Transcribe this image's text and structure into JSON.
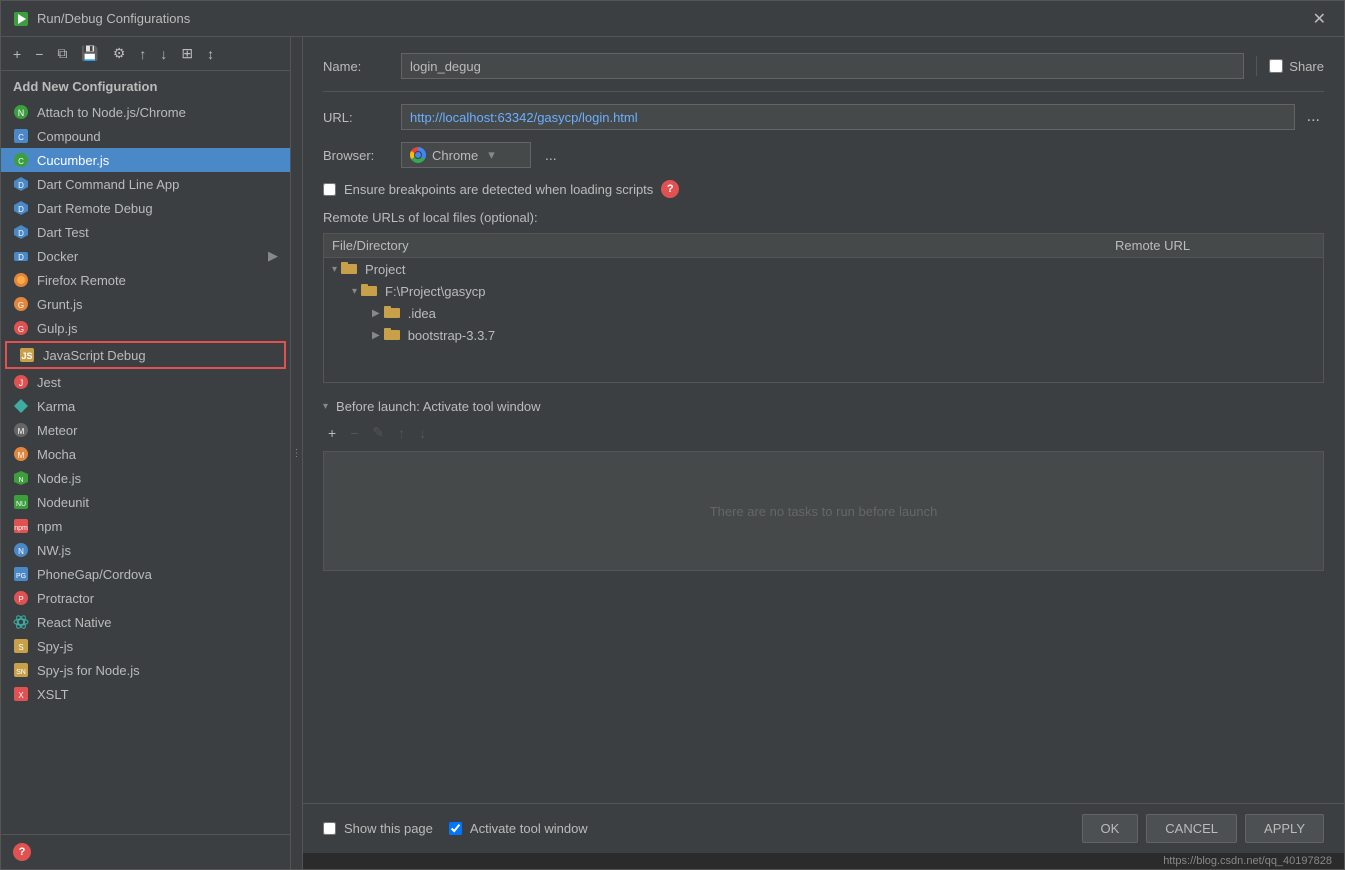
{
  "dialog": {
    "title": "Run/Debug Configurations",
    "close_label": "✕"
  },
  "toolbar": {
    "add_label": "+",
    "remove_label": "−",
    "copy_label": "⧉",
    "save_label": "💾",
    "settings_label": "⚙",
    "move_up_label": "↑",
    "move_down_label": "↓",
    "layout_label": "⊞",
    "sort_label": "↕"
  },
  "left_panel": {
    "title": "Add New Configuration",
    "items": [
      {
        "id": "attach-nodejs-chrome",
        "label": "Attach to Node.js/Chrome",
        "icon": "nodejs",
        "color": "#3d9e3d"
      },
      {
        "id": "compound",
        "label": "Compound",
        "icon": "compound",
        "color": "#4a88c7"
      },
      {
        "id": "cucumberjs",
        "label": "Cucumber.js",
        "icon": "cucumber",
        "color": "#3d9e3d",
        "selected": true
      },
      {
        "id": "dart-command-line",
        "label": "Dart Command Line App",
        "icon": "dart",
        "color": "#4a88c7"
      },
      {
        "id": "dart-remote-debug",
        "label": "Dart Remote Debug",
        "icon": "dart",
        "color": "#4a88c7"
      },
      {
        "id": "dart-test",
        "label": "Dart Test",
        "icon": "dart",
        "color": "#4a88c7"
      },
      {
        "id": "docker",
        "label": "Docker",
        "icon": "docker",
        "color": "#4a88c7",
        "has_arrow": true
      },
      {
        "id": "firefox-remote",
        "label": "Firefox Remote",
        "icon": "firefox",
        "color": "#e0873d"
      },
      {
        "id": "grunt",
        "label": "Grunt.js",
        "icon": "grunt",
        "color": "#e0873d"
      },
      {
        "id": "gulp",
        "label": "Gulp.js",
        "icon": "gulp",
        "color": "#e05252"
      },
      {
        "id": "javascript-debug",
        "label": "JavaScript Debug",
        "icon": "jsdebug",
        "color": "#c8a04a",
        "highlighted": true
      },
      {
        "id": "jest",
        "label": "Jest",
        "icon": "jest",
        "color": "#e05252"
      },
      {
        "id": "karma",
        "label": "Karma",
        "icon": "karma",
        "color": "#3dada3"
      },
      {
        "id": "meteor",
        "label": "Meteor",
        "icon": "meteor",
        "color": "#bbbbbb"
      },
      {
        "id": "mocha",
        "label": "Mocha",
        "icon": "mocha",
        "color": "#e0873d"
      },
      {
        "id": "nodejs",
        "label": "Node.js",
        "icon": "nodejs2",
        "color": "#3d9e3d"
      },
      {
        "id": "nodeunit",
        "label": "Nodeunit",
        "icon": "nodeunit",
        "color": "#3d9e3d"
      },
      {
        "id": "npm",
        "label": "npm",
        "icon": "npm",
        "color": "#e05252"
      },
      {
        "id": "nwjs",
        "label": "NW.js",
        "icon": "nwjs",
        "color": "#4a88c7"
      },
      {
        "id": "phonegap",
        "label": "PhoneGap/Cordova",
        "icon": "phonegap",
        "color": "#4a88c7"
      },
      {
        "id": "protractor",
        "label": "Protractor",
        "icon": "protractor",
        "color": "#e05252"
      },
      {
        "id": "react-native",
        "label": "React Native",
        "icon": "react",
        "color": "#3dada3"
      },
      {
        "id": "spy-js",
        "label": "Spy-js",
        "icon": "spy",
        "color": "#c8a04a"
      },
      {
        "id": "spy-js-node",
        "label": "Spy-js for Node.js",
        "icon": "spy2",
        "color": "#c8a04a"
      },
      {
        "id": "xslt",
        "label": "XSLT",
        "icon": "xslt",
        "color": "#e05252"
      }
    ]
  },
  "right_panel": {
    "name_label": "Name:",
    "name_value": "login_degug",
    "share_label": "Share",
    "url_label": "URL:",
    "url_value": "http://localhost:63342/gasycp/login.html",
    "url_more": "...",
    "browser_label": "Browser:",
    "browser_value": "Chrome",
    "browser_more": "...",
    "ensure_breakpoints_label": "Ensure breakpoints are detected when loading scripts",
    "remote_urls_label": "Remote URLs of local files (optional):",
    "file_dir_col": "File/Directory",
    "remote_url_col": "Remote URL",
    "tree": {
      "project_label": "Project",
      "path_label": "F:\\Project\\gasycp",
      "idea_label": ".idea",
      "bootstrap_label": "bootstrap-3.3.7"
    },
    "before_launch_label": "Before launch: Activate tool window",
    "no_tasks_label": "There are no tasks to run before launch",
    "show_page_label": "Show this page",
    "activate_window_label": "Activate tool window"
  },
  "buttons": {
    "ok_label": "OK",
    "cancel_label": "CANCEL",
    "apply_label": "APPLY"
  },
  "status_bar": {
    "url": "https://blog.csdn.net/qq_40197828"
  },
  "help_icon": "?",
  "bottom_help_icon": "?"
}
